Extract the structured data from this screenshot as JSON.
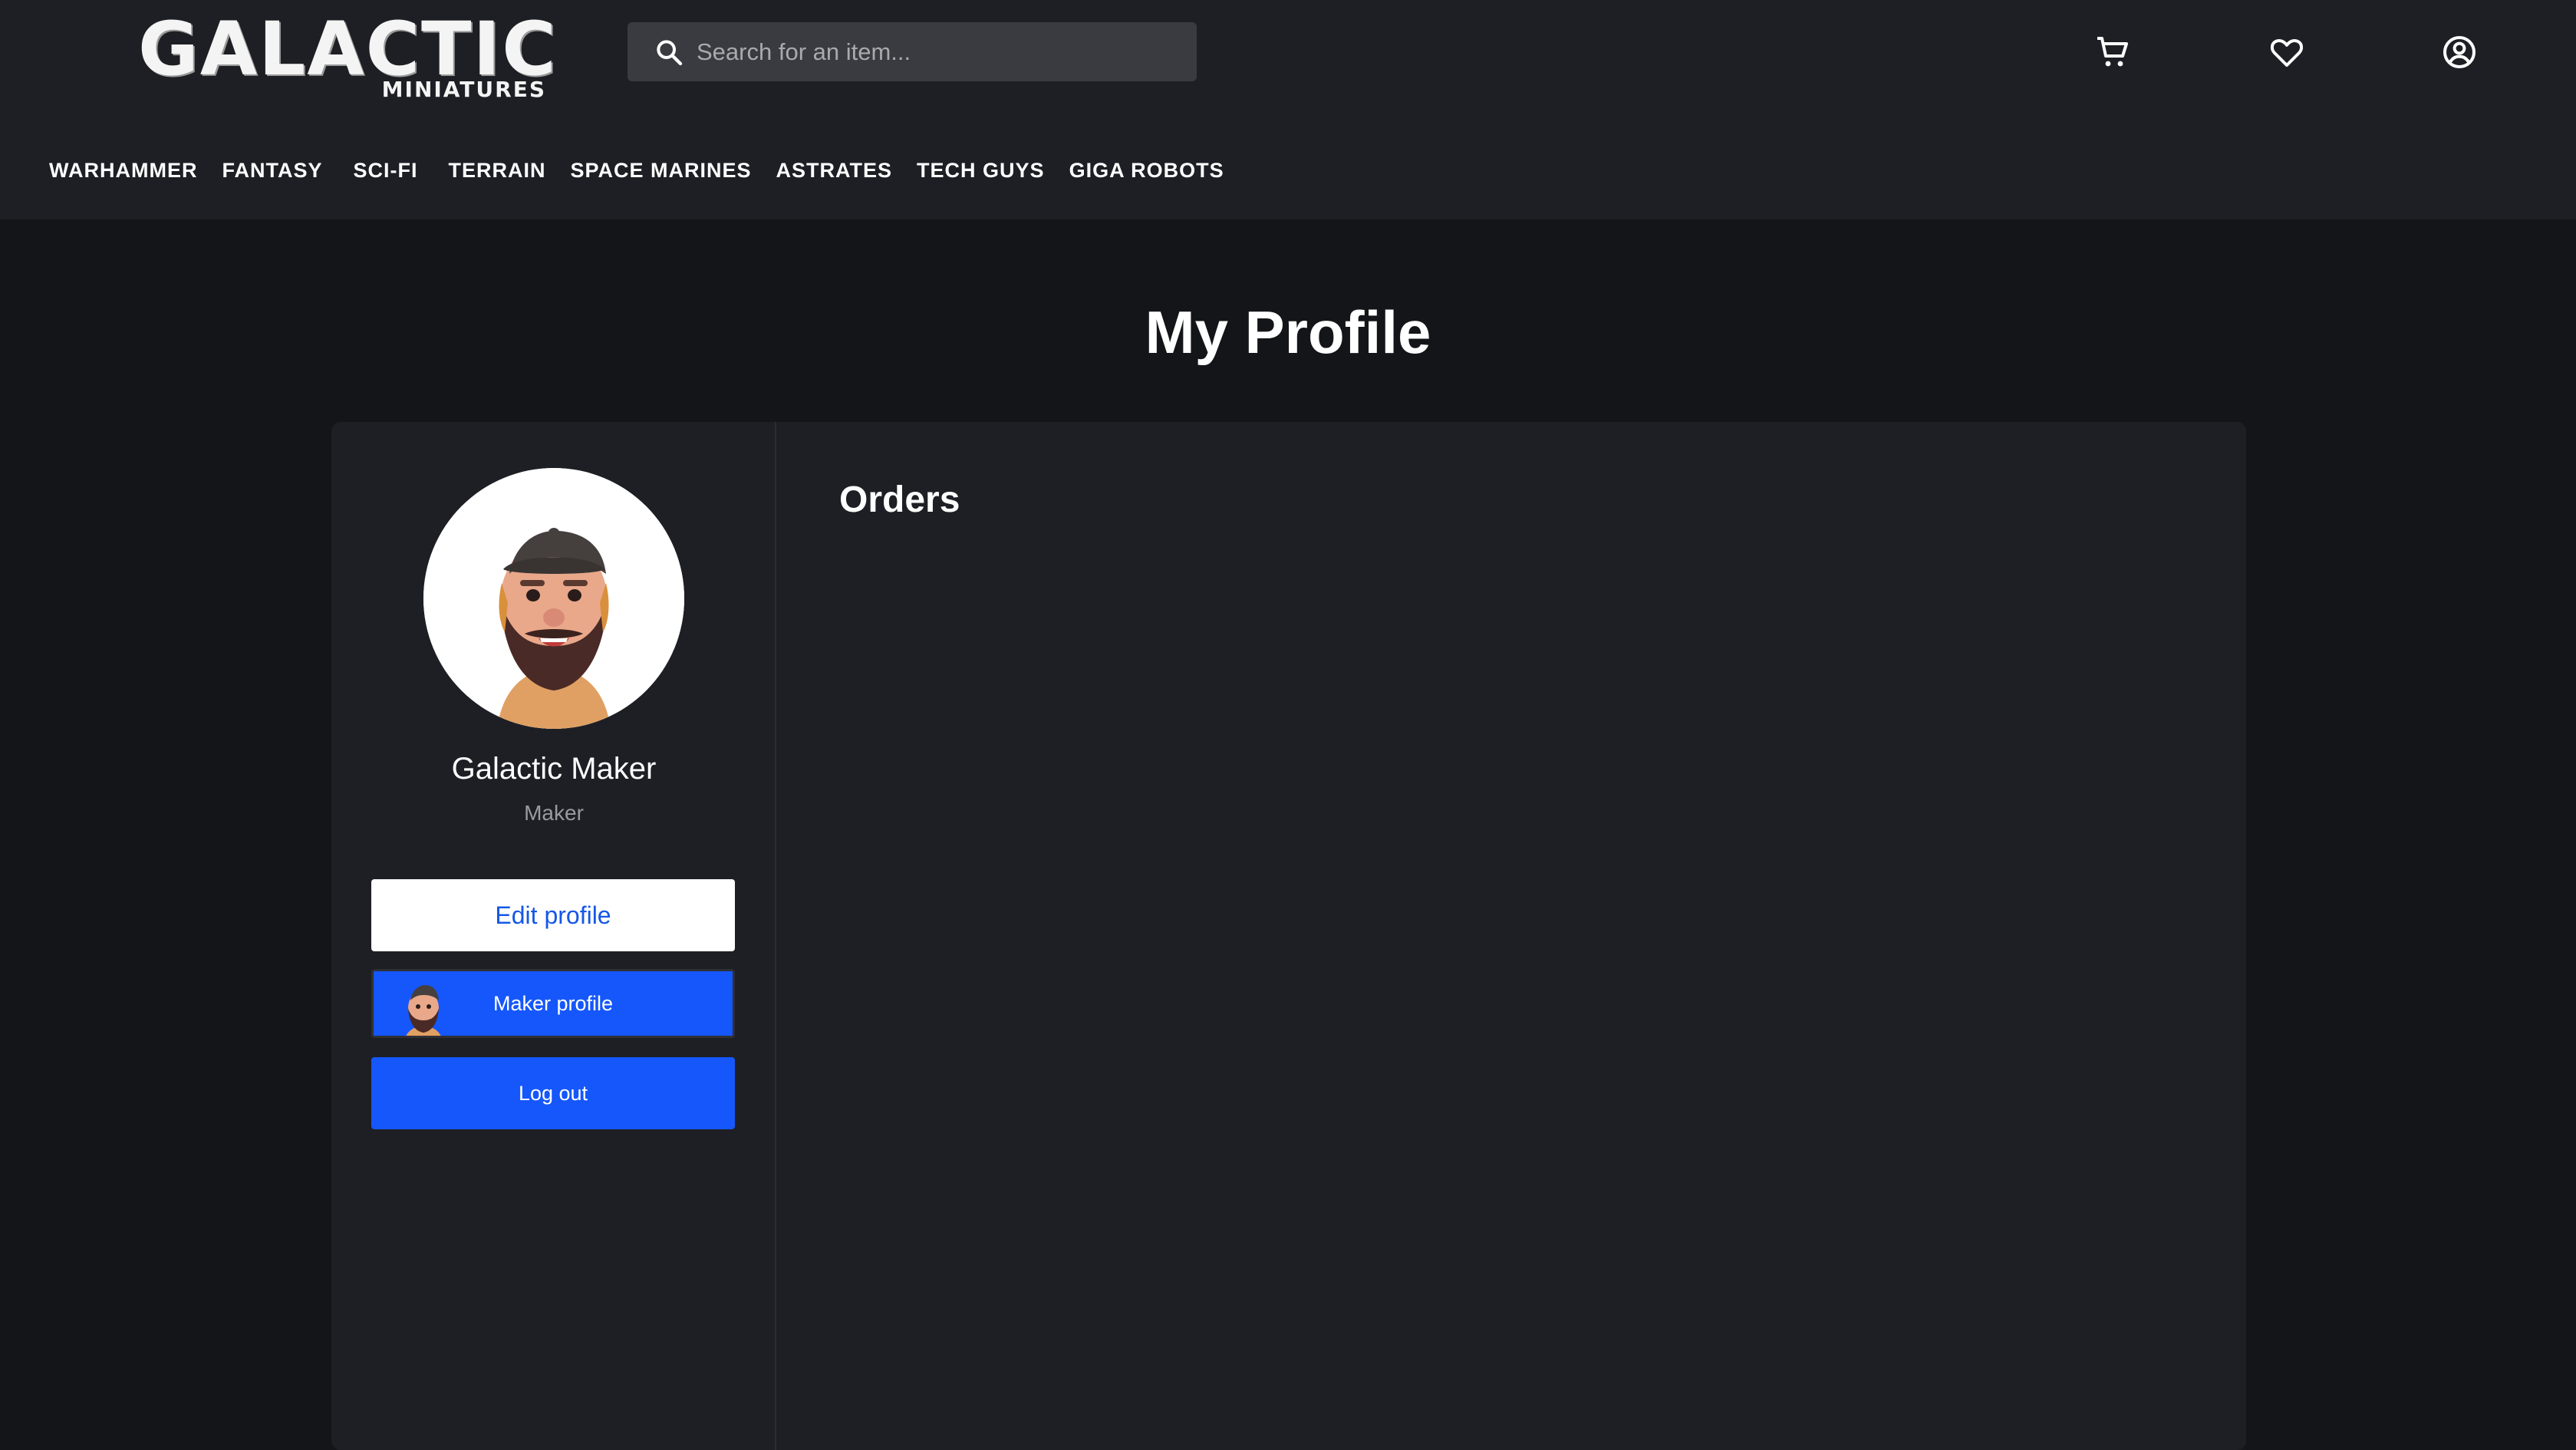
{
  "brand": {
    "name": "GALACTIC",
    "tagline": "MINIATURES"
  },
  "search": {
    "placeholder": "Search for an item..."
  },
  "header_icons": [
    "cart-icon",
    "heart-icon",
    "account-icon"
  ],
  "nav": [
    "WARHAMMER",
    "FANTASY",
    "SCI-FI",
    "TERRAIN",
    "SPACE MARINES",
    "ASTRATES",
    "TECH GUYS",
    "GIGA ROBOTS"
  ],
  "page": {
    "title": "My Profile"
  },
  "profile": {
    "name": "Galactic Maker",
    "role": "Maker",
    "edit_label": "Edit profile",
    "maker_label": "Maker profile",
    "logout_label": "Log out"
  },
  "orders": {
    "title": "Orders"
  },
  "colors": {
    "background": "#141518",
    "header": "#1e1f24",
    "card": "#1e1f24",
    "primary": "#1557fb",
    "search": "#3a3b40"
  }
}
